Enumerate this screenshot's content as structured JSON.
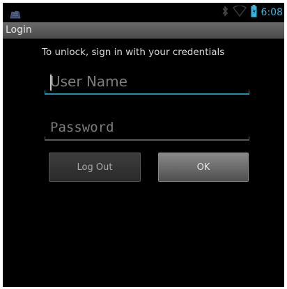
{
  "status_bar": {
    "time": "6:08",
    "icons": [
      "app-notification-icon",
      "bluetooth-icon",
      "wifi-icon",
      "battery-icon"
    ],
    "time_color": "#33b5e5"
  },
  "title_bar": {
    "title": "Login"
  },
  "prompt": "To unlock, sign in with your credentials",
  "form": {
    "username": {
      "placeholder": "User Name",
      "value": "",
      "focused": true
    },
    "password": {
      "placeholder": "Password",
      "value": ""
    }
  },
  "buttons": {
    "logout": "Log Out",
    "ok": "OK"
  },
  "colors": {
    "accent": "#1f90b5",
    "background": "#000000"
  }
}
